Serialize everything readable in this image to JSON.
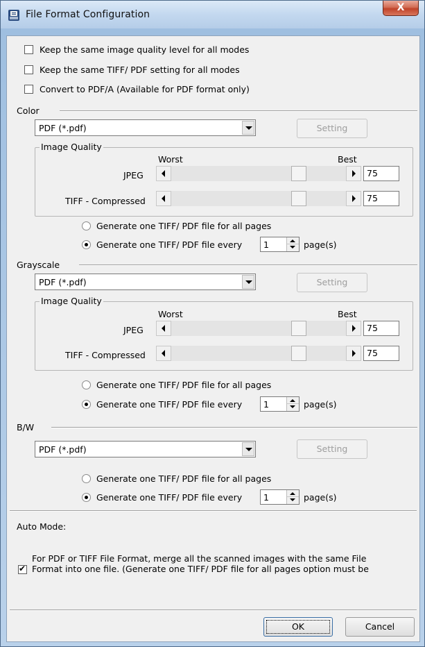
{
  "window": {
    "title": "File Format Configuration",
    "close_glyph": "X"
  },
  "options": {
    "same_quality": "Keep the same image quality level for all modes",
    "same_tiff_pdf": "Keep the same TIFF/ PDF setting for all modes",
    "pdfa": "Convert to PDF/A (Available for PDF format only)"
  },
  "color": {
    "heading": "Color",
    "format": "PDF (*.pdf)",
    "setting": "Setting",
    "iq_title": "Image Quality",
    "worst": "Worst",
    "best": "Best",
    "jpeg_label": "JPEG",
    "jpeg_value": "75",
    "tiff_label": "TIFF - Compressed",
    "tiff_value": "75",
    "radio_all": "Generate one TIFF/ PDF file for all pages",
    "radio_every": "Generate one TIFF/ PDF file every",
    "pages_value": "1",
    "pages_unit": "page(s)"
  },
  "grayscale": {
    "heading": "Grayscale",
    "format": "PDF (*.pdf)",
    "setting": "Setting",
    "iq_title": "Image Quality",
    "worst": "Worst",
    "best": "Best",
    "jpeg_label": "JPEG",
    "jpeg_value": "75",
    "tiff_label": "TIFF - Compressed",
    "tiff_value": "75",
    "radio_all": "Generate one TIFF/ PDF file for all pages",
    "radio_every": "Generate one TIFF/ PDF file every",
    "pages_value": "1",
    "pages_unit": "page(s)"
  },
  "bw": {
    "heading": "B/W",
    "format": "PDF (*.pdf)",
    "setting": "Setting",
    "radio_all": "Generate one TIFF/ PDF file for all pages",
    "radio_every": "Generate one TIFF/ PDF file every",
    "pages_value": "1",
    "pages_unit": "page(s)"
  },
  "auto": {
    "heading": "Auto Mode:",
    "merge_line1": "For PDF or TIFF File Format, merge all the scanned images with the same File",
    "merge_line2": "Format into one file. (Generate one TIFF/ PDF file for all pages option must be"
  },
  "footer": {
    "ok": "OK",
    "cancel": "Cancel"
  },
  "colors": {
    "accent": "#b9d1ea",
    "close_red": "#c0432a",
    "dialog_bg": "#f0f0f0"
  }
}
